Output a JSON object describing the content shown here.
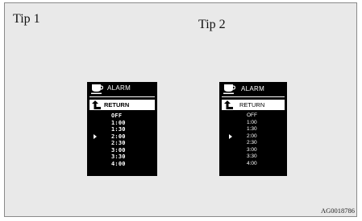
{
  "tips": [
    {
      "label": "Tip 1"
    },
    {
      "label": "Tip 2"
    }
  ],
  "screen1": {
    "header": "ALARM",
    "return_label": "RETURN",
    "options": [
      "OFF",
      "1:00",
      "1:30",
      "2:00",
      "2:30",
      "3:00",
      "3:30",
      "4:00"
    ],
    "selected": "2:00"
  },
  "screen2": {
    "header": "ALARM",
    "return_label": "RETURN",
    "options": [
      "OFF",
      "1:00",
      "1:30",
      "2:00",
      "2:30",
      "3:00",
      "3:30",
      "4:00"
    ],
    "selected": "2:00"
  },
  "figure_code": "AG0018786",
  "icons": {
    "header_icon": "alarm-cup-icon",
    "return_icon": "return-arrow-icon",
    "selector_icon": "selection-triangle-icon"
  }
}
